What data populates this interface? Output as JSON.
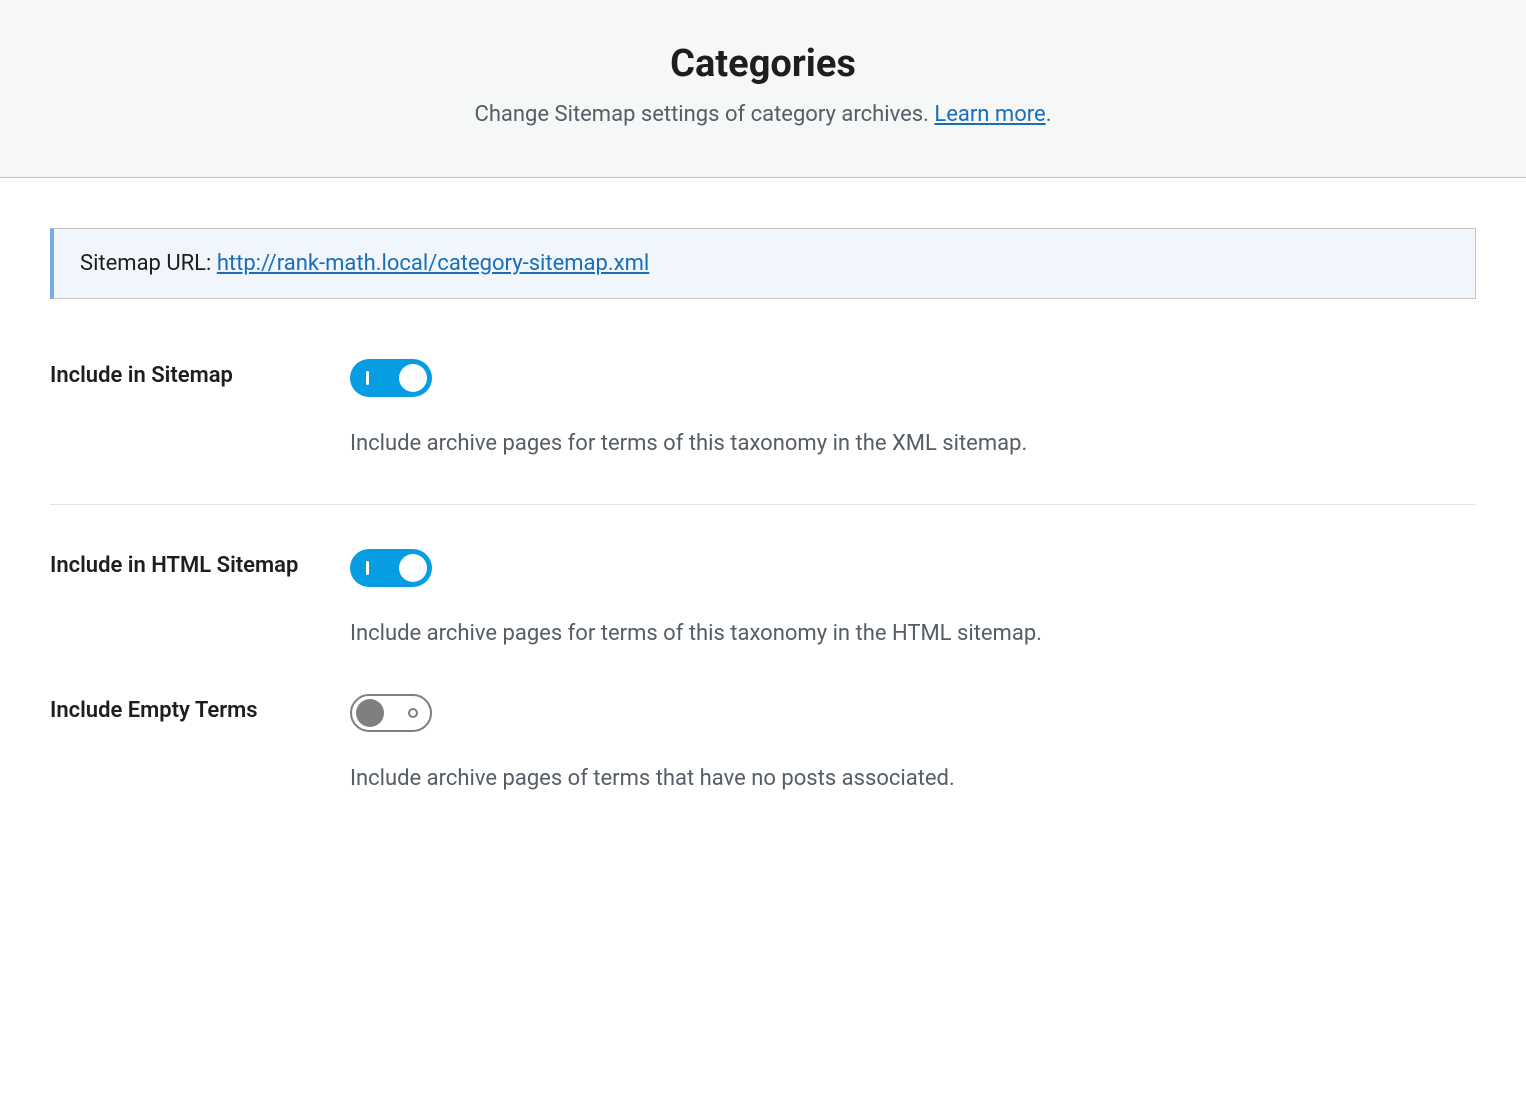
{
  "header": {
    "title": "Categories",
    "description_prefix": "Change Sitemap settings of category archives. ",
    "learn_more_text": "Learn more",
    "description_suffix": "."
  },
  "notice": {
    "label": "Sitemap URL: ",
    "url": "http://rank-math.local/category-sitemap.xml"
  },
  "settings": [
    {
      "label": "Include in Sitemap",
      "enabled": true,
      "help": "Include archive pages for terms of this taxonomy in the XML sitemap."
    },
    {
      "label": "Include in HTML Sitemap",
      "enabled": true,
      "help": "Include archive pages for terms of this taxonomy in the HTML sitemap."
    },
    {
      "label": "Include Empty Terms",
      "enabled": false,
      "help": "Include archive pages of terms that have no posts associated."
    }
  ]
}
